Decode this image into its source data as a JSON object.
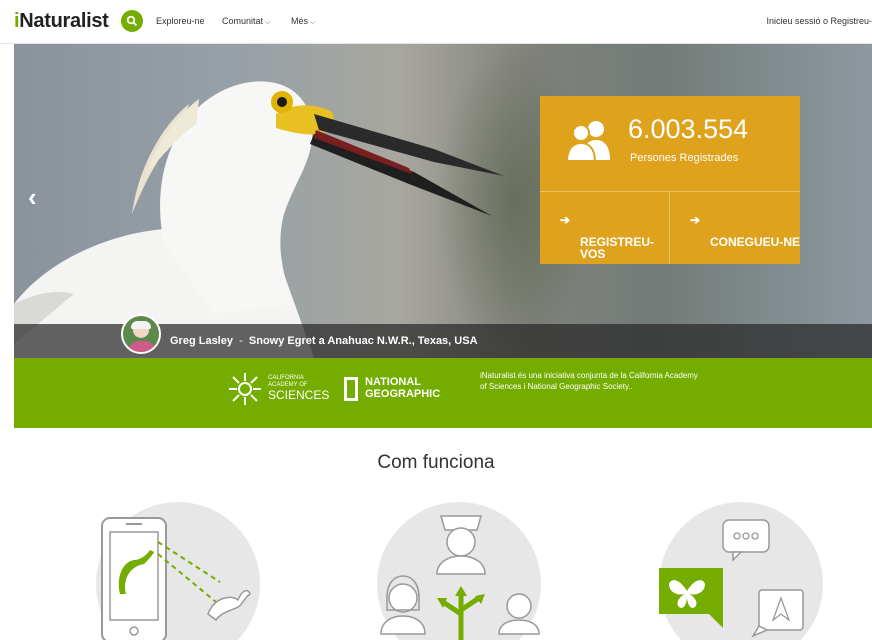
{
  "nav": {
    "logo_prefix": "i",
    "logo_rest": "Naturalist",
    "items": [
      {
        "label": "Exploreu-ne"
      },
      {
        "label": "Comunitat"
      },
      {
        "label": "Més"
      }
    ],
    "auth_text": "Inicieu sessió o Registreu-"
  },
  "hero": {
    "stats_count": "6.003.554",
    "stats_label": "Persones Registrades",
    "cta_signup": "REGISTREU-VOS",
    "cta_learn": "CONEGUEU-NE",
    "photographer": "Greg Lasley",
    "separator": "-",
    "photo_caption": "Snowy Egret a Anahuac N.W.R., Texas, USA"
  },
  "partners": {
    "cas_line1": "CALIFORNIA",
    "cas_line2": "ACADEMY OF",
    "cas_line3": "SCIENCES",
    "ng_line1": "NATIONAL",
    "ng_line2": "GEOGRAPHIC",
    "blurb": "iNaturalist és una iniciativa conjunta de la California Academy of Sciences i National Geographic Society.."
  },
  "how": {
    "title": "Com funciona"
  },
  "colors": {
    "brand_green": "#74ac00",
    "stats_orange": "#dfa21c"
  },
  "icons": [
    "search-icon",
    "chevron-down-icon",
    "arrow-left-icon",
    "people-icon",
    "circle-arrow-icon",
    "academy-logo-icon",
    "natgeo-logo-icon",
    "phone-observation-icon",
    "community-icon",
    "identification-icon"
  ]
}
